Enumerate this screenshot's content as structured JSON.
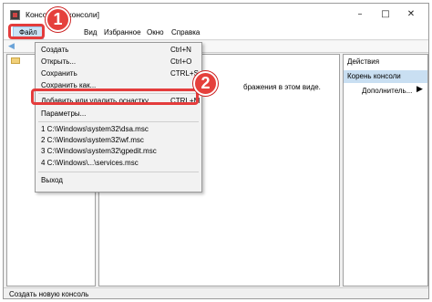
{
  "window": {
    "title": "Консол      ень консоли]",
    "minimize": "–",
    "maximize": "□",
    "close": "✕"
  },
  "menubar": {
    "file": "Файл",
    "view": "Вид",
    "favorites": "Избранное",
    "window": "Окно",
    "help": "Справка"
  },
  "file_menu": {
    "items": [
      {
        "label": "Создать",
        "shortcut": "Ctrl+N"
      },
      {
        "label": "Открыть...",
        "shortcut": "Ctrl+O"
      },
      {
        "label": "Сохранить",
        "shortcut": "CTRL+S"
      },
      {
        "label": "Сохранить как...",
        "shortcut": ""
      },
      {
        "label": "Добавить или удалить оснастку...",
        "shortcut": "CTRL+M"
      },
      {
        "label": "Параметры...",
        "shortcut": ""
      },
      {
        "label": "1 C:\\Windows\\system32\\dsa.msc",
        "shortcut": ""
      },
      {
        "label": "2 C:\\Windows\\system32\\wf.msc",
        "shortcut": ""
      },
      {
        "label": "3 C:\\Windows\\system32\\gpedit.msc",
        "shortcut": ""
      },
      {
        "label": "4 C:\\Windows\\...\\services.msc",
        "shortcut": ""
      },
      {
        "label": "Выход",
        "shortcut": ""
      }
    ]
  },
  "center": {
    "empty_text": "бражения в этом виде."
  },
  "actions": {
    "header": "Действия",
    "section": "Корень консоли",
    "more": "Дополнитель..."
  },
  "status": {
    "text": "Создать новую консоль"
  },
  "annotations": {
    "step1": "1",
    "step2": "2",
    "color": "#e43c3c"
  }
}
